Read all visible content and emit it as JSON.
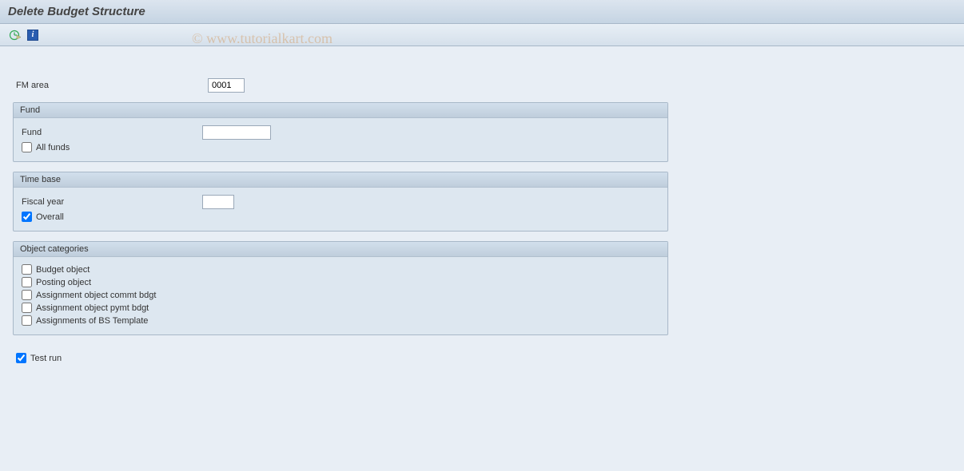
{
  "title": "Delete Budget Structure",
  "watermark": "© www.tutorialkart.com",
  "toolbar": {
    "execute_icon": "execute-icon",
    "info_icon": "info-icon"
  },
  "fields": {
    "fm_area_label": "FM area",
    "fm_area_value": "0001"
  },
  "groups": {
    "fund": {
      "title": "Fund",
      "fund_label": "Fund",
      "fund_value": "",
      "all_funds_label": "All funds",
      "all_funds_checked": false
    },
    "time_base": {
      "title": "Time base",
      "fiscal_year_label": "Fiscal year",
      "fiscal_year_value": "",
      "overall_label": "Overall",
      "overall_checked": true
    },
    "object_categories": {
      "title": "Object categories",
      "items": [
        {
          "label": "Budget object",
          "checked": false
        },
        {
          "label": "Posting object",
          "checked": false
        },
        {
          "label": "Assignment object commt bdgt",
          "checked": false
        },
        {
          "label": "Assignment object pymt bdgt",
          "checked": false
        },
        {
          "label": "Assignments of BS Template",
          "checked": false
        }
      ]
    }
  },
  "test_run": {
    "label": "Test run",
    "checked": true
  }
}
